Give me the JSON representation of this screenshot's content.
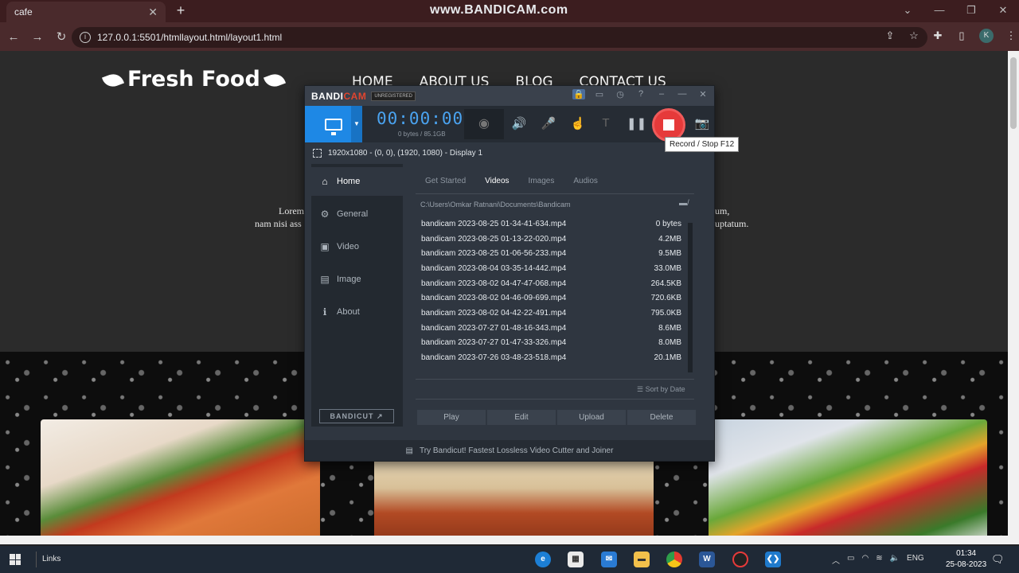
{
  "browser": {
    "tab_title": "cafe",
    "tab_close": "✕",
    "new_tab": "+",
    "watermark": "www.BANDICAM.com",
    "url": "127.0.0.1:5501/htmllayout.html/layout1.html",
    "win_controls": [
      "⌄",
      "—",
      "❐",
      "✕"
    ],
    "nav": {
      "back": "←",
      "forward": "→",
      "reload": "↻"
    },
    "profile_initial": "K"
  },
  "site": {
    "logo": "Fresh Food",
    "nav_items": [
      "HOME",
      "ABOUT US",
      "BLOG",
      "CONTACT US"
    ],
    "lorem_left_1": "Lorem",
    "lorem_left_2": "nam nisi ass",
    "lorem_right_1": "um,",
    "lorem_right_2": "uptatum."
  },
  "bandicam": {
    "logo_main": "BANDI",
    "logo_accent": "CAM",
    "unregistered": "UNREGISTERED",
    "timer": "00:00:00",
    "bytes": "0 bytes / 85.1GB",
    "tooltip": "Record / Stop   F12",
    "target": "1920x1080 - (0, 0), (1920, 1080) - Display 1",
    "sidebar": [
      {
        "label": "Home",
        "icon": "home-icon",
        "glyph": "⌂",
        "active": true
      },
      {
        "label": "General",
        "icon": "gear-icon",
        "glyph": "⚙",
        "active": false
      },
      {
        "label": "Video",
        "icon": "video-settings-icon",
        "glyph": "▣",
        "active": false
      },
      {
        "label": "Image",
        "icon": "image-settings-icon",
        "glyph": "▤",
        "active": false
      },
      {
        "label": "About",
        "icon": "info-icon",
        "glyph": "ℹ",
        "active": false
      }
    ],
    "bandicut_button": "BANDICUT ↗",
    "tabs": [
      "Get Started",
      "Videos",
      "Images",
      "Audios"
    ],
    "selected_tab": "Videos",
    "path": "C:\\Users\\Omkar Ratnani\\Documents\\Bandicam",
    "files": [
      {
        "name": "bandicam 2023-08-25 01-34-41-634.mp4",
        "size": "0 bytes"
      },
      {
        "name": "bandicam 2023-08-25 01-13-22-020.mp4",
        "size": "4.2MB"
      },
      {
        "name": "bandicam 2023-08-25 01-06-56-233.mp4",
        "size": "9.5MB"
      },
      {
        "name": "bandicam 2023-08-04 03-35-14-442.mp4",
        "size": "33.0MB"
      },
      {
        "name": "bandicam 2023-08-02 04-47-47-068.mp4",
        "size": "264.5KB"
      },
      {
        "name": "bandicam 2023-08-02 04-46-09-699.mp4",
        "size": "720.6KB"
      },
      {
        "name": "bandicam 2023-08-02 04-42-22-491.mp4",
        "size": "795.0KB"
      },
      {
        "name": "bandicam 2023-07-27 01-48-16-343.mp4",
        "size": "8.6MB"
      },
      {
        "name": "bandicam 2023-07-27 01-47-33-326.mp4",
        "size": "8.0MB"
      },
      {
        "name": "bandicam 2023-07-26 03-48-23-518.mp4",
        "size": "20.1MB"
      }
    ],
    "sort_label": "Sort by Date",
    "actions": [
      "Play",
      "Edit",
      "Upload",
      "Delete"
    ],
    "footer": "Try Bandicut! Fastest Lossless Video Cutter and Joiner"
  },
  "taskbar": {
    "links": "Links",
    "language": "ENG",
    "time": "01:34",
    "date": "25-08-2023"
  },
  "colors": {
    "bandicam_accent": "#1e88e5",
    "record_red": "#e63a3a",
    "timer_blue": "#4aa3f0"
  }
}
